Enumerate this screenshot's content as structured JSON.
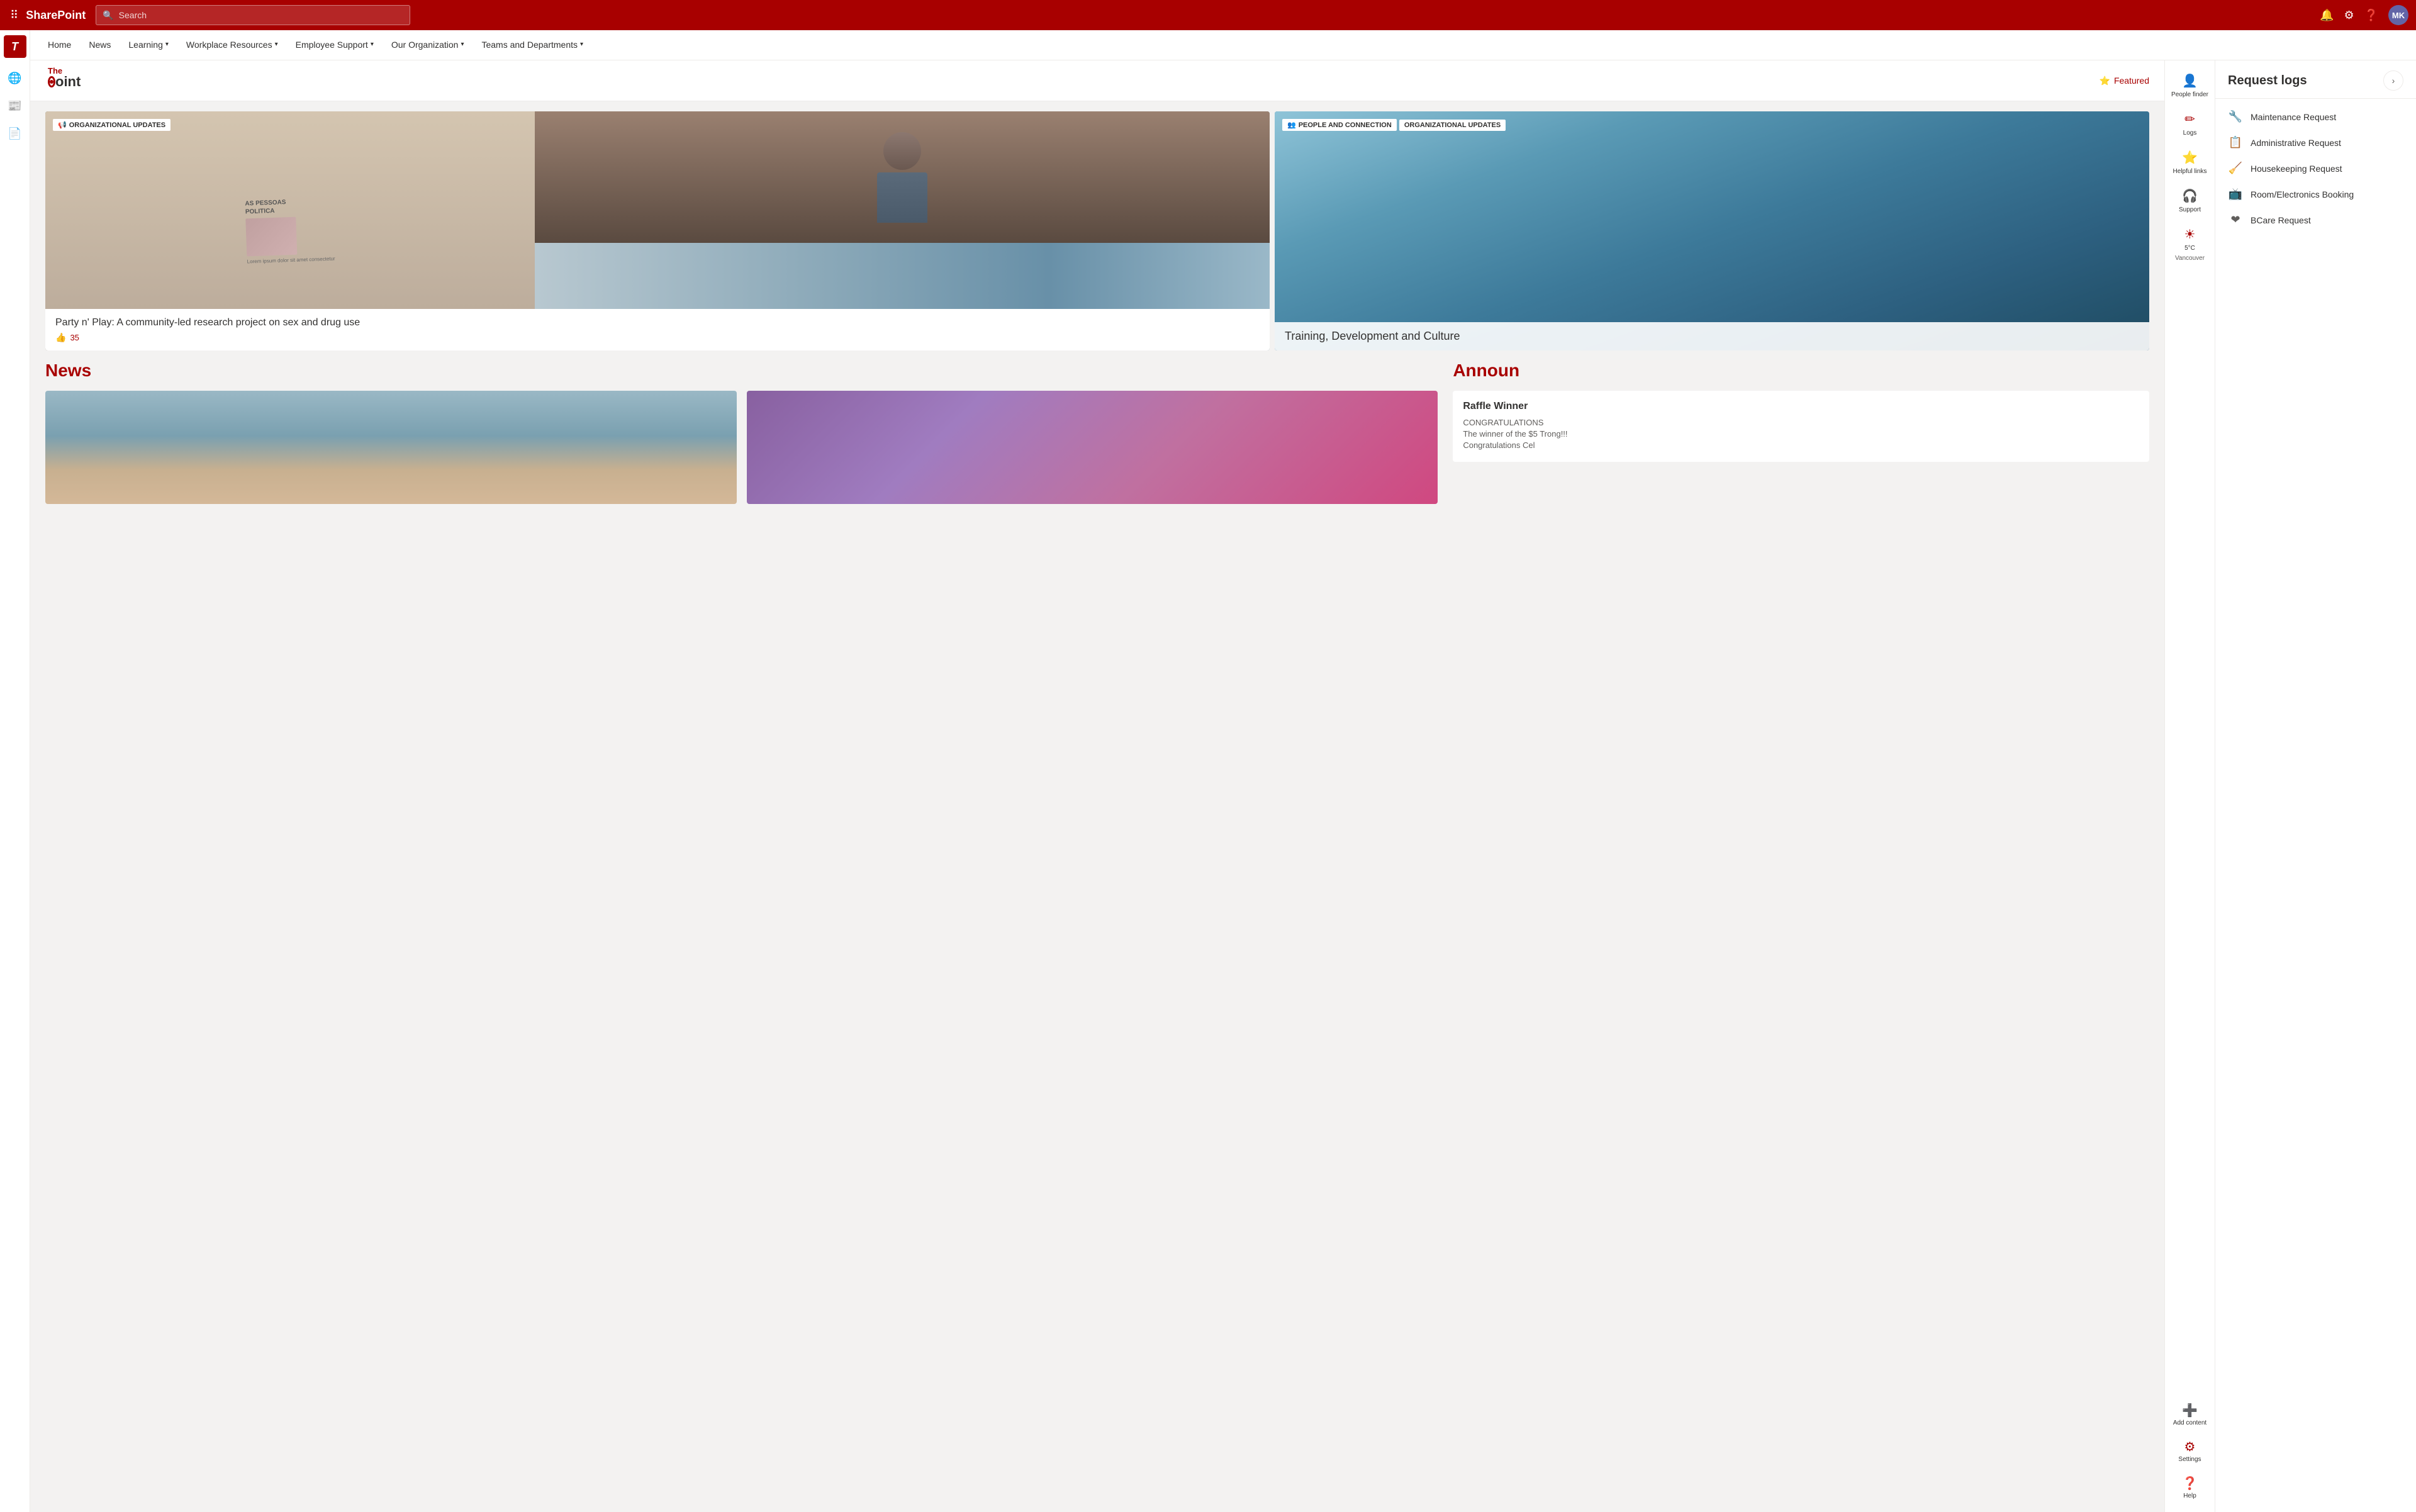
{
  "topbar": {
    "apps_label": "⠿",
    "brand": "SharePoint",
    "search_placeholder": "Search",
    "avatar_initials": "MK"
  },
  "left_sidebar": {
    "logo_text": "T"
  },
  "nav": {
    "items": [
      {
        "label": "Home",
        "has_dropdown": false
      },
      {
        "label": "News",
        "has_dropdown": false
      },
      {
        "label": "Learning",
        "has_dropdown": true
      },
      {
        "label": "Workplace Resources",
        "has_dropdown": true
      },
      {
        "label": "Employee Support",
        "has_dropdown": true
      },
      {
        "label": "Our Organization",
        "has_dropdown": true
      },
      {
        "label": "Teams and Departments",
        "has_dropdown": true
      }
    ]
  },
  "featured": {
    "label": "Featured"
  },
  "hero": {
    "left": {
      "tag_icon": "📢",
      "tag_label": "ORGANIZATIONAL UPDATES",
      "title": "Party n' Play: A community-led research project on sex and drug use",
      "likes": 35
    },
    "right": {
      "tag_icon": "👥",
      "tag_people": "PEOPLE AND CONNECTION",
      "tag_org": "ORGANIZATIONAL UPDATES",
      "title": "Training, Development and Culture"
    }
  },
  "news": {
    "title": "News",
    "cards": [
      {
        "id": 1
      },
      {
        "id": 2
      }
    ]
  },
  "announcements": {
    "title": "Announ",
    "cards": [
      {
        "title": "Raffle Winner",
        "text_1": "CONGRATULATIONS",
        "text_2": "The winner of the $5 Trong!!!",
        "text_3": "Congratulations Cel"
      }
    ]
  },
  "right_panel": {
    "title": "Request logs",
    "items": [
      {
        "icon": "🔧",
        "label": "Maintenance Request"
      },
      {
        "icon": "📋",
        "label": "Administrative Request"
      },
      {
        "icon": "🧹",
        "label": "Housekeeping Request"
      },
      {
        "icon": "📺",
        "label": "Room/Electronics Booking"
      },
      {
        "icon": "❤",
        "label": "BCare Request"
      }
    ]
  },
  "quick_actions": {
    "items": [
      {
        "icon": "👤",
        "label": "People finder"
      },
      {
        "icon": "✏",
        "label": "Logs"
      },
      {
        "icon": "⭐",
        "label": "Helpful links"
      },
      {
        "icon": "🎧",
        "label": "Support"
      },
      {
        "icon": "☀",
        "label": "5°C",
        "sub": "Vancouver"
      }
    ],
    "bottom": [
      {
        "icon": "➕",
        "label": "Add content"
      },
      {
        "icon": "⚙",
        "label": "Settings"
      },
      {
        "icon": "❓",
        "label": "Help"
      }
    ]
  }
}
